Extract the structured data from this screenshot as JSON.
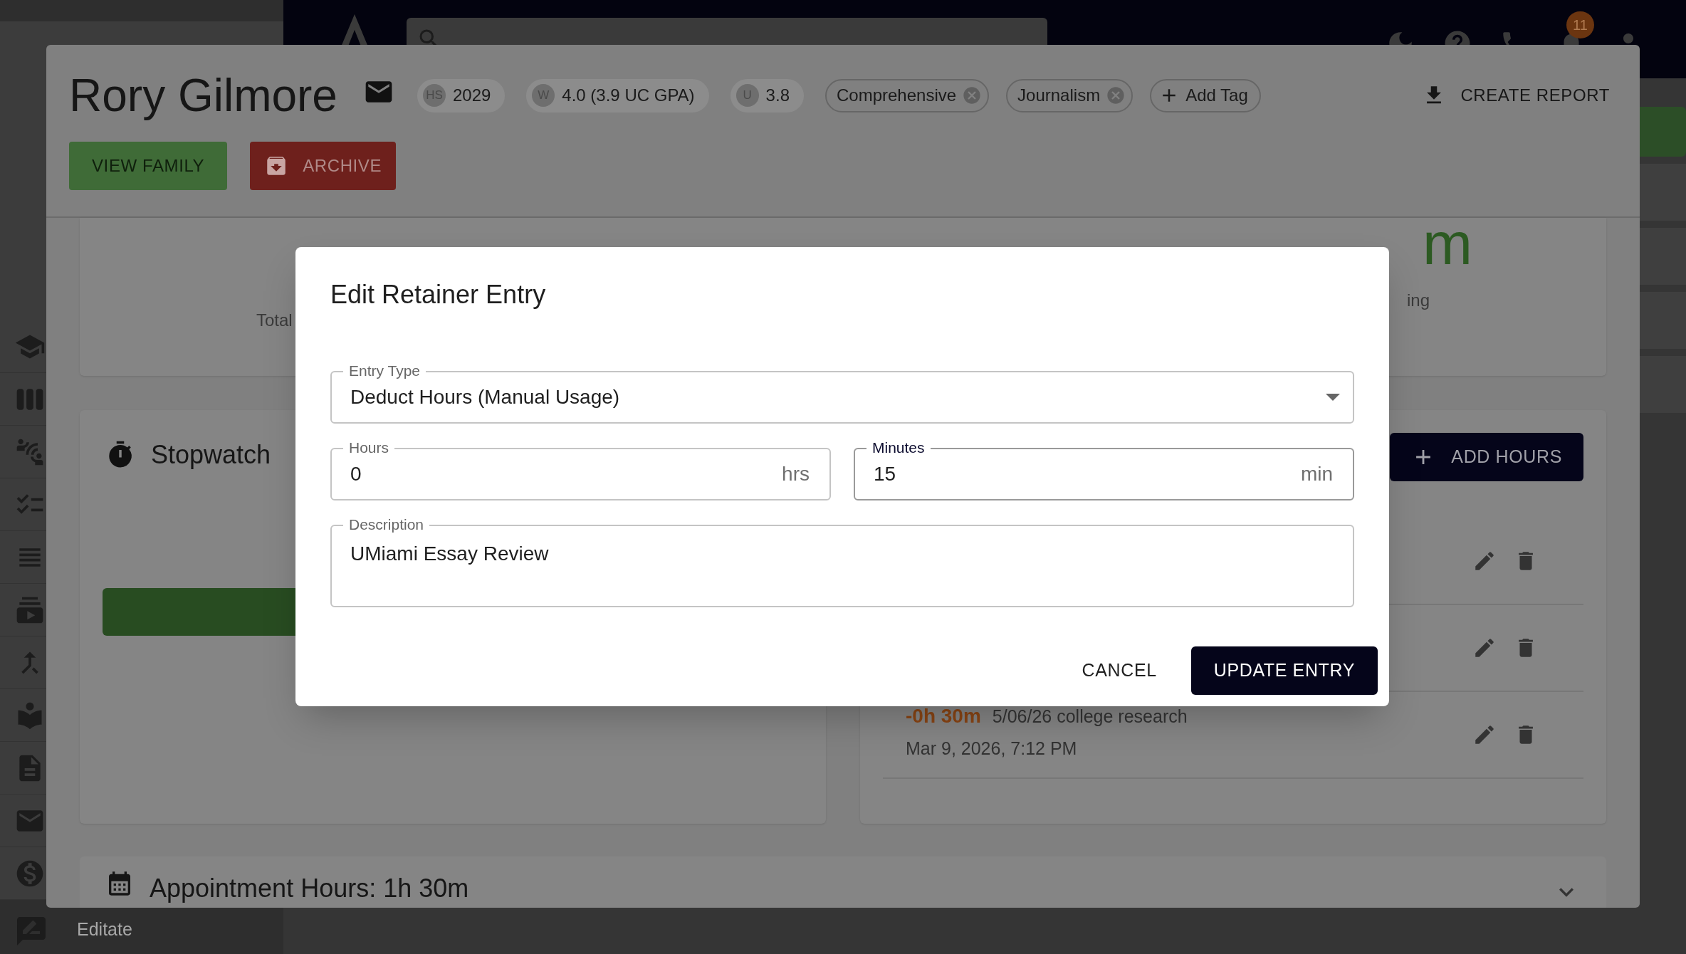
{
  "sidebar": {
    "footer_label": "Editate"
  },
  "navbar": {
    "notification_count": "11"
  },
  "student": {
    "name": "Rory Gilmore",
    "chips": [
      {
        "prefix": "HS",
        "value": "2029"
      },
      {
        "prefix": "W",
        "value": "4.0 (3.9 UC GPA)"
      },
      {
        "prefix": "U",
        "value": "3.8"
      }
    ],
    "tags": [
      {
        "label": "Comprehensive"
      },
      {
        "label": "Journalism"
      }
    ],
    "add_tag": "Add Tag",
    "create_report": "CREATE REPORT",
    "buttons": [
      {
        "label": "VIEW FAMILY",
        "kind": "success"
      },
      {
        "label": "ARCHIVE",
        "kind": "danger"
      }
    ]
  },
  "summary": {
    "left_label": "Total",
    "right_value": "m",
    "right_label": "ing"
  },
  "stopwatch": {
    "title": "Stopwatch"
  },
  "retainer": {
    "add_button": "ADD HOURS",
    "entries": [
      {
        "kind": "covered"
      },
      {
        "kind": "covered"
      },
      {
        "kind": "entry",
        "amount": "-0h 30m",
        "description": "5/06/26 college research",
        "date": "Mar 9, 2026, 7:12 PM"
      }
    ]
  },
  "appointments": {
    "title": "Appointment Hours: 1h 30m"
  },
  "dialog": {
    "title": "Edit Retainer Entry",
    "fields": [
      {
        "kind": "select",
        "label": "Entry Type",
        "value": "Deduct Hours (Manual Usage)",
        "focused": false
      },
      {
        "kind": "number",
        "label": "Hours",
        "value": "0",
        "suffix": "hrs",
        "focused": false
      },
      {
        "kind": "number",
        "label": "Minutes",
        "value": "15",
        "suffix": "min",
        "focused": true
      },
      {
        "kind": "textarea",
        "label": "Description",
        "value": "UMiami Essay Review",
        "focused": false
      }
    ],
    "actions": [
      {
        "kind": "text",
        "label": "CANCEL"
      },
      {
        "kind": "primary",
        "label": "UPDATE ENTRY"
      }
    ]
  }
}
